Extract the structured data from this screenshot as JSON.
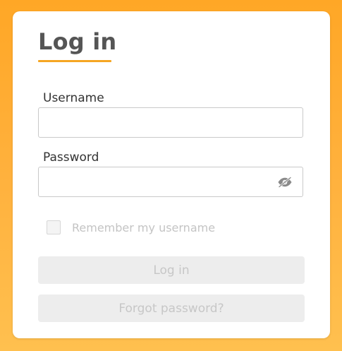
{
  "form": {
    "title": "Log in",
    "username_label": "Username",
    "username_value": "",
    "password_label": "Password",
    "password_value": "",
    "remember_label": "Remember my username",
    "remember_checked": false,
    "login_button": "Log in",
    "forgot_button": "Forgot password?",
    "password_toggle_icon": "eye-slash-icon"
  },
  "colors": {
    "background_top": "#FFA726",
    "background_bottom": "#FFC04F",
    "accent": "#F5A623",
    "title_text": "#555555",
    "disabled_text": "#C7C7C7",
    "disabled_button_bg": "#EDEDED"
  }
}
